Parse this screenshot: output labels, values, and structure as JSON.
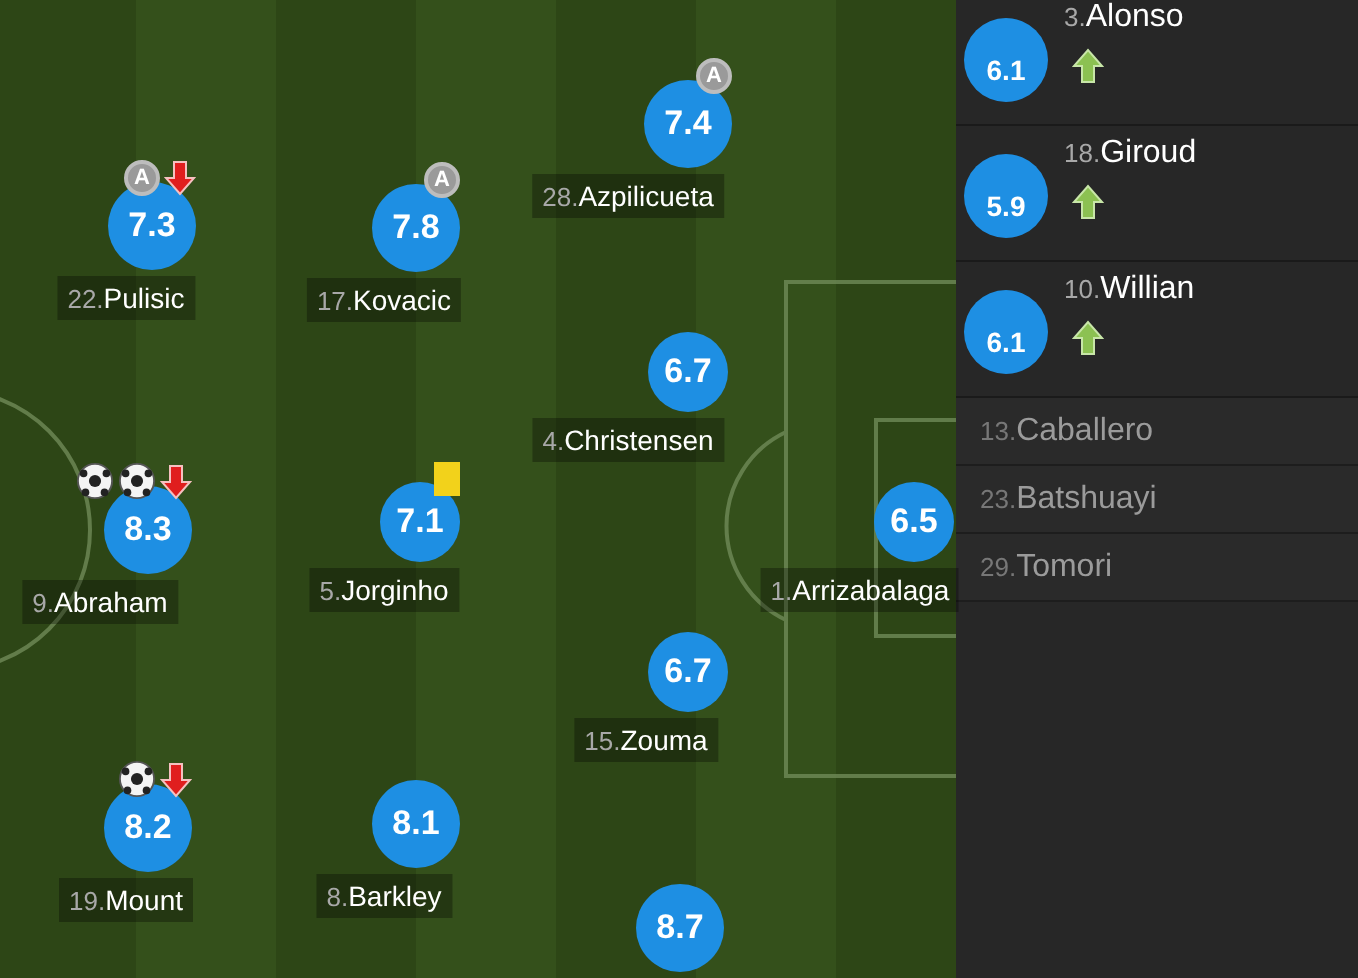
{
  "pitch": {
    "players": [
      {
        "number": "22.",
        "name": "Pulisic",
        "rating": "7.3",
        "events": [
          {
            "kind": "assist",
            "text": "A"
          },
          {
            "kind": "sub_off"
          }
        ]
      },
      {
        "number": "17.",
        "name": "Kovacic",
        "rating": "7.8",
        "events": [
          {
            "kind": "assist",
            "text": "A"
          }
        ]
      },
      {
        "number": "28.",
        "name": "Azpilicueta",
        "rating": "7.4",
        "events": [
          {
            "kind": "assist",
            "text": "A"
          }
        ]
      },
      {
        "number": "4.",
        "name": "Christensen",
        "rating": "6.7"
      },
      {
        "number": "9.",
        "name": "Abraham",
        "rating": "8.3",
        "events": [
          {
            "kind": "goal"
          },
          {
            "kind": "goal"
          },
          {
            "kind": "sub_off"
          }
        ]
      },
      {
        "number": "5.",
        "name": "Jorginho",
        "rating": "7.1",
        "events": [
          {
            "kind": "yellow_card"
          }
        ]
      },
      {
        "number": "1.",
        "name": "Arrizabalaga",
        "rating": "6.5"
      },
      {
        "number": "15.",
        "name": "Zouma",
        "rating": "6.7"
      },
      {
        "number": "19.",
        "name": "Mount",
        "rating": "8.2",
        "events": [
          {
            "kind": "goal"
          },
          {
            "kind": "sub_off"
          }
        ]
      },
      {
        "number": "8.",
        "name": "Barkley",
        "rating": "8.1"
      },
      {
        "rating": "8.7"
      }
    ]
  },
  "bench": {
    "substitutes": [
      {
        "number": "3.",
        "name": "Alonso",
        "rating": "6.1",
        "subbed_on": true
      },
      {
        "number": "18.",
        "name": "Giroud",
        "rating": "5.9",
        "subbed_on": true
      },
      {
        "number": "10.",
        "name": "Willian",
        "rating": "6.1",
        "subbed_on": true
      }
    ],
    "unused": [
      {
        "number": "13.",
        "name": "Caballero"
      },
      {
        "number": "23.",
        "name": "Batshuayi"
      },
      {
        "number": "29.",
        "name": "Tomori"
      }
    ]
  }
}
